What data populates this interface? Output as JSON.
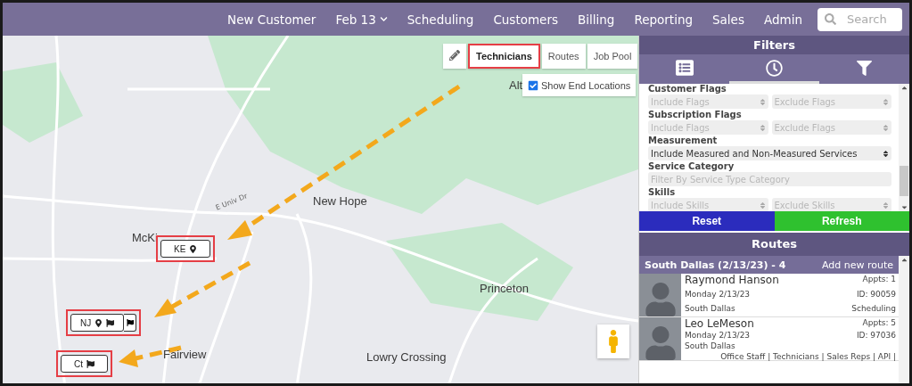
{
  "nav": {
    "items": [
      {
        "label": "New Customer",
        "dropdown": false
      },
      {
        "label": "Feb 13",
        "dropdown": true
      },
      {
        "label": "Scheduling",
        "dropdown": false
      },
      {
        "label": "Customers",
        "dropdown": false
      },
      {
        "label": "Billing",
        "dropdown": false
      },
      {
        "label": "Reporting",
        "dropdown": false
      },
      {
        "label": "Sales",
        "dropdown": false
      },
      {
        "label": "Admin",
        "dropdown": false
      }
    ],
    "search": {
      "placeholder": "Search"
    }
  },
  "map": {
    "place_labels": [
      {
        "text": "Alt"
      },
      {
        "text": "New Hope"
      },
      {
        "text": "McKi"
      },
      {
        "text": "Princeton"
      },
      {
        "text": "Fairview"
      },
      {
        "text": "Lowry Crossing"
      }
    ],
    "road_labels": [
      {
        "text": "E Univ Dr"
      }
    ],
    "view_tabs": [
      {
        "label": "Technicians",
        "selected": true,
        "highlighted": true
      },
      {
        "label": "Routes",
        "selected": false,
        "highlighted": false
      },
      {
        "label": "Job Pool",
        "selected": false,
        "highlighted": false
      }
    ],
    "show_end_locations": {
      "label": "Show End Locations",
      "checked": true
    },
    "markers": [
      {
        "label": "KE",
        "pin": true,
        "flag": false,
        "highlighted": true,
        "stacked": false
      },
      {
        "label": "NJ",
        "pin": true,
        "flag": true,
        "highlighted": true,
        "stacked": true
      },
      {
        "label": "Ct",
        "pin": false,
        "flag": true,
        "highlighted": true,
        "stacked": false
      }
    ]
  },
  "filters": {
    "title": "Filters",
    "tabs": [
      {
        "kind": "list",
        "selected": false
      },
      {
        "kind": "clock",
        "selected": true
      },
      {
        "kind": "funnel",
        "selected": false
      }
    ],
    "groups": [
      {
        "label": "Customer Flags",
        "fields": [
          {
            "kind": "select",
            "placeholder": "Include Flags"
          },
          {
            "kind": "select",
            "placeholder": "Exclude Flags"
          }
        ]
      },
      {
        "label": "Subscription Flags",
        "fields": [
          {
            "kind": "select",
            "placeholder": "Include Flags"
          },
          {
            "kind": "select",
            "placeholder": "Exclude Flags"
          }
        ]
      },
      {
        "label": "Measurement",
        "fields": [
          {
            "kind": "dropdown",
            "value": "Include Measured and Non-Measured Services"
          }
        ]
      },
      {
        "label": "Service Category",
        "fields": [
          {
            "kind": "text",
            "placeholder": "Filter By Service Type Category"
          }
        ]
      },
      {
        "label": "Skills",
        "fields": [
          {
            "kind": "select",
            "placeholder": "Include Skills"
          },
          {
            "kind": "select",
            "placeholder": "Exclude Skills"
          }
        ]
      }
    ],
    "reset": "Reset",
    "refresh": "Refresh"
  },
  "routes": {
    "title": "Routes",
    "group": {
      "title": "South Dallas (2/13/23) - 4",
      "action": "Add new route"
    },
    "technicians": [
      {
        "name": "Raymond Hanson",
        "date": "Monday 2/13/23",
        "area": "South Dallas",
        "appts": "Appts: 1",
        "id": "ID: 90059",
        "role": "Scheduling"
      },
      {
        "name": "Leo LeMeson",
        "date": "Monday 2/13/23",
        "area": "South Dallas",
        "appts": "Appts: 5",
        "id": "ID: 97036",
        "role": "Office Staff | Technicians | Sales Reps | API |"
      }
    ]
  }
}
